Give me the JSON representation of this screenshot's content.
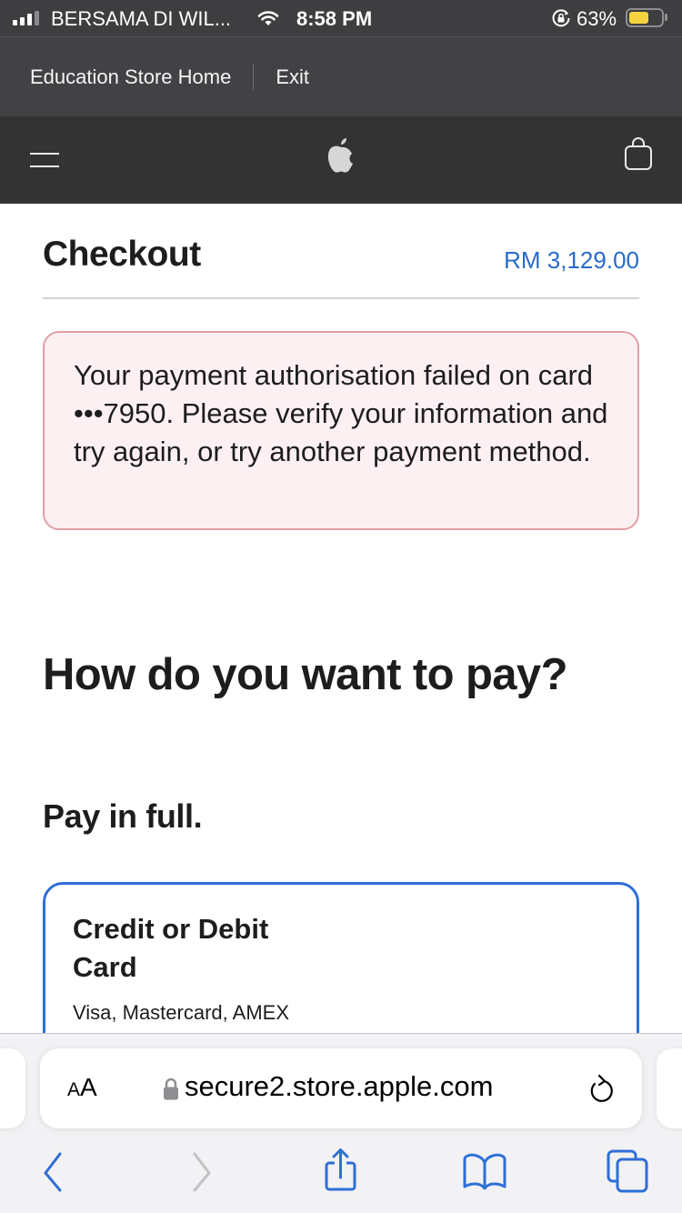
{
  "status_bar": {
    "carrier": "BERSAMA DI WIL...",
    "time": "8:58 PM",
    "battery_percent": "63%",
    "battery_level": 0.63,
    "signal_bars": 3,
    "signal_bars_total": 4,
    "icons": [
      "signal-icon",
      "wifi-icon",
      "rotation-lock-icon",
      "battery-icon"
    ]
  },
  "edu_nav": {
    "home_label": "Education Store Home",
    "exit_label": "Exit"
  },
  "global_nav": {
    "icons": [
      "menu-icon",
      "apple-logo-icon",
      "bag-icon"
    ]
  },
  "checkout": {
    "title": "Checkout",
    "total": "RM 3,129.00"
  },
  "error": {
    "message": "Your payment authorisation failed on card •••7950. Please verify your information and try again, or try another payment method."
  },
  "payment": {
    "heading": "How do you want to pay?",
    "subheading": "Pay in full.",
    "options": [
      {
        "title": "Credit or Debit Card",
        "subtitle": "Visa, Mastercard, AMEX"
      }
    ]
  },
  "browser": {
    "text_size_label_small": "A",
    "text_size_label_large": "A",
    "url": "secure2.store.apple.com",
    "icons": [
      "lock-icon",
      "reload-icon",
      "back-icon",
      "forward-icon",
      "share-icon",
      "bookmarks-icon",
      "tabs-icon"
    ]
  },
  "colors": {
    "accent_blue": "#2f6fd6",
    "price_blue": "#2a6bc8",
    "error_bg": "#fdf0f2",
    "error_border": "#e0a0a4",
    "battery_fill": "#f6d43f"
  }
}
